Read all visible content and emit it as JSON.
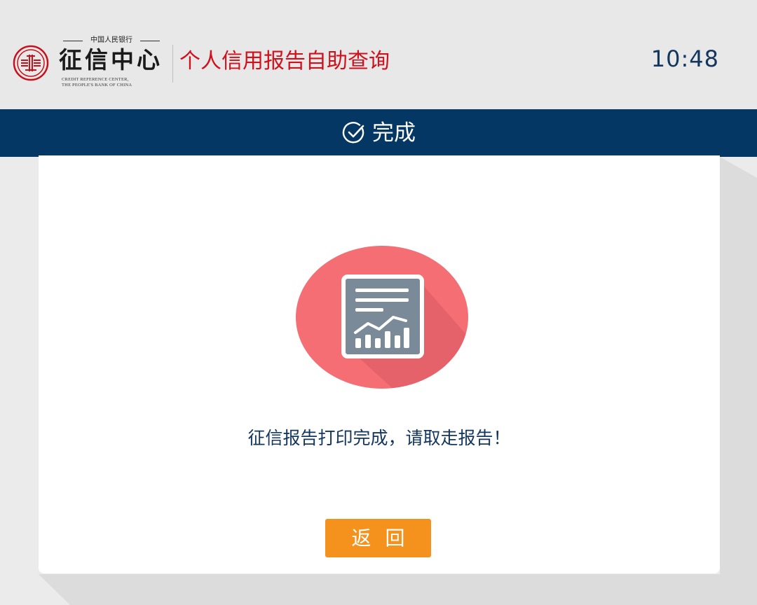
{
  "header": {
    "logo_topline": "中国人民银行",
    "logo_main": "征信中心",
    "logo_en_line1": "CREDIT REFERENCE CENTER,",
    "logo_en_line2": "THE PEOPLE'S BANK OF CHINA",
    "app_title": "个人信用报告自助查询",
    "clock": "10:48"
  },
  "step": {
    "label": "完成",
    "icon": "check-circle-icon"
  },
  "main": {
    "icon": "report-chart-icon",
    "message": "征信报告打印完成，请取走报告！",
    "back_label": "返回"
  },
  "colors": {
    "brand_red": "#d0101b",
    "navy": "#053765",
    "text_navy": "#13365e",
    "button_orange": "#f5921e",
    "badge_red": "#f46e73",
    "doc_gray": "#7a8a99"
  }
}
